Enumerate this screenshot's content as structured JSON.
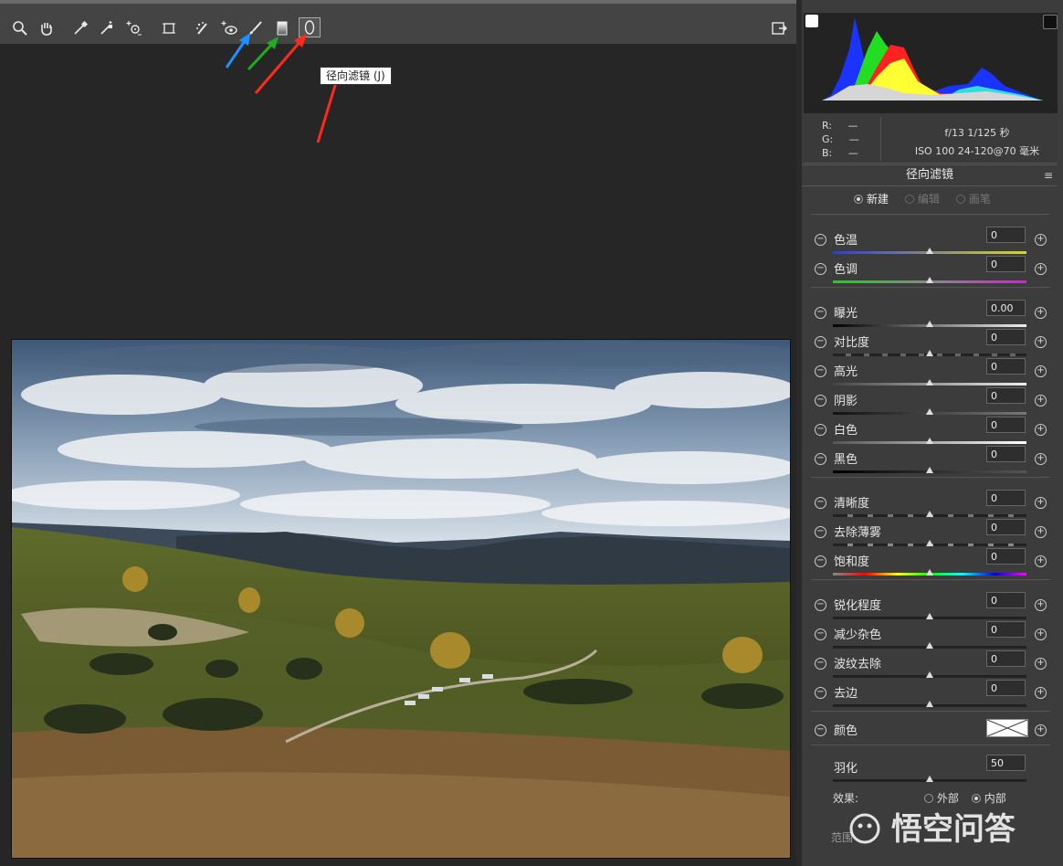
{
  "toolbar": {
    "tools": [
      "zoom-tool",
      "hand-tool",
      "white-balance-tool",
      "color-sampler-tool",
      "targeted-adjustment-tool",
      "transform-tool",
      "spot-removal-tool",
      "red-eye-tool",
      "adjustment-brush-tool",
      "graduated-filter-tool",
      "radial-filter-tool"
    ]
  },
  "tooltip": "径向滤镜 (J)",
  "info": {
    "r_label": "R:",
    "g_label": "G:",
    "b_label": "B:",
    "r_value": "—",
    "g_value": "—",
    "b_value": "—",
    "exposure": "f/13  1/125 秒",
    "iso": "ISO 100  24-120@70 毫米"
  },
  "panel": {
    "title": "径向滤镜",
    "modes": [
      "新建",
      "编辑",
      "画笔"
    ],
    "selected_mode": "新建"
  },
  "sliders": [
    {
      "label": "色温",
      "value": "0"
    },
    {
      "label": "色调",
      "value": "0"
    },
    {
      "label": "曝光",
      "value": "0.00"
    },
    {
      "label": "对比度",
      "value": "0"
    },
    {
      "label": "高光",
      "value": "0"
    },
    {
      "label": "阴影",
      "value": "0"
    },
    {
      "label": "白色",
      "value": "0"
    },
    {
      "label": "黑色",
      "value": "0"
    },
    {
      "label": "清晰度",
      "value": "0"
    },
    {
      "label": "去除薄雾",
      "value": "0"
    },
    {
      "label": "饱和度",
      "value": "0"
    },
    {
      "label": "锐化程度",
      "value": "0"
    },
    {
      "label": "减少杂色",
      "value": "0"
    },
    {
      "label": "波纹去除",
      "value": "0"
    },
    {
      "label": "去边",
      "value": "0"
    }
  ],
  "color": {
    "label": "颜色"
  },
  "feather": {
    "label": "羽化",
    "value": "50"
  },
  "effect": {
    "label": "效果:",
    "options": [
      "外部",
      "内部"
    ],
    "selected": "内部"
  },
  "range_label": "范围",
  "watermark": "悟空问答",
  "accent_colors": {
    "blue_arrow": "#1e90ff",
    "green_arrow": "#22aa22",
    "red_arrow": "#ff2a1a"
  }
}
